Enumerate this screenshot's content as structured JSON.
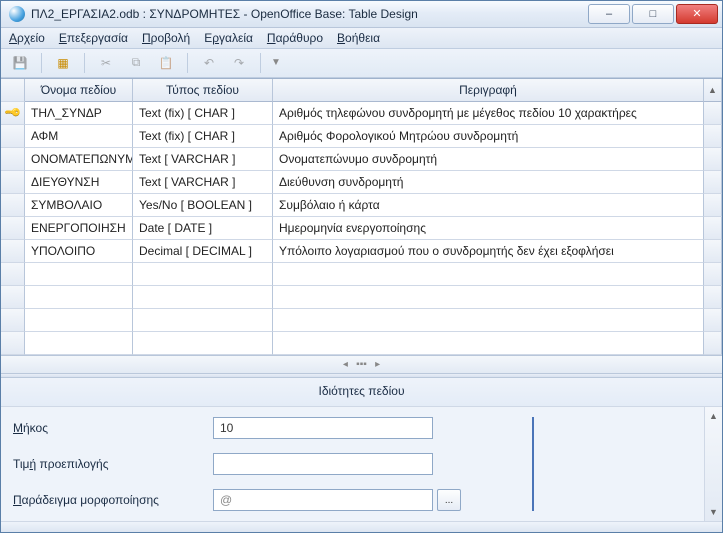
{
  "window": {
    "title": "ΠΛ2_ΕΡΓΑΣΙΑ2.odb : ΣΥΝΔΡΟΜΗΤΕΣ - OpenOffice Base: Table Design"
  },
  "menu": {
    "file": "Αρχείο",
    "edit": "Επεξεργασία",
    "view": "Προβολή",
    "tools": "Εργαλεία",
    "window": "Παράθυρο",
    "help": "Βοήθεια"
  },
  "grid": {
    "headers": {
      "name": "Όνομα πεδίου",
      "type": "Τύπος πεδίου",
      "desc": "Περιγραφή"
    },
    "rows": [
      {
        "pk": true,
        "name": "ΤΗΛ_ΣΥΝΔΡ",
        "type": "Text (fix) [ CHAR ]",
        "desc": "Αριθμός τηλεφώνου συνδρομητή με μέγεθος πεδίου 10 χαρακτήρες"
      },
      {
        "pk": false,
        "name": "ΑΦΜ",
        "type": "Text (fix) [ CHAR ]",
        "desc": "Αριθμός Φορολογικού Μητρώου συνδρομητή"
      },
      {
        "pk": false,
        "name": "ΟΝΟΜΑΤΕΠΩΝΥΜΟ",
        "type": "Text [ VARCHAR ]",
        "desc": "Ονοματεπώνυμο συνδρομητή"
      },
      {
        "pk": false,
        "name": "ΔΙΕΥΘΥΝΣΗ",
        "type": "Text [ VARCHAR ]",
        "desc": "Διεύθυνση συνδρομητή"
      },
      {
        "pk": false,
        "name": "ΣΥΜΒΟΛΑΙΟ",
        "type": "Yes/No [ BOOLEAN ]",
        "desc": "Συμβόλαιο ή κάρτα"
      },
      {
        "pk": false,
        "name": "ΕΝΕΡΓΟΠΟΙΗΣΗ",
        "type": "Date [ DATE ]",
        "desc": "Ημερομηνία ενεργοποίησης"
      },
      {
        "pk": false,
        "name": "ΥΠΟΛΟΙΠΟ",
        "type": "Decimal [ DECIMAL ]",
        "desc": "Υπόλοιπο λογαριασμού που ο συνδρομητής δεν έχει εξοφλήσει"
      }
    ],
    "empty_rows": 4
  },
  "properties": {
    "title": "Ιδιότητες πεδίου",
    "length_label": "Μήκος",
    "length_value": "10",
    "default_label": "Τιμή προεπιλογής",
    "default_value": "",
    "format_label": "Παράδειγμα μορφοποίησης",
    "format_value": "@",
    "format_button": "..."
  }
}
